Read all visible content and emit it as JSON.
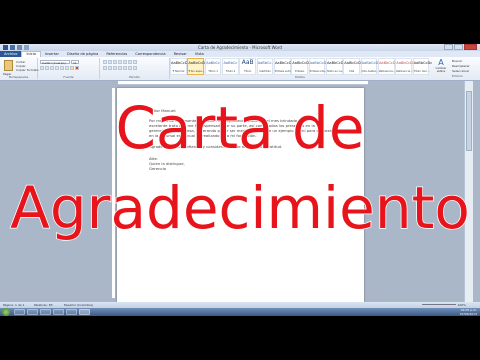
{
  "window": {
    "title": "Carta de Agradecimiento - Microsoft Word"
  },
  "ribbon": {
    "tabs": [
      "Archivo",
      "Inicio",
      "Insertar",
      "Diseño de página",
      "Referencias",
      "Correspondencia",
      "Revisar",
      "Vista"
    ],
    "active_tab": "Inicio",
    "clipboard": {
      "paste_label": "Pegar",
      "cut_label": "Cortar",
      "copy_label": "Copiar",
      "format_painter_label": "Copiar formato",
      "group_label": "Portapapeles"
    },
    "font": {
      "font_name": "Calibri (Cuerpo)",
      "font_size": "11",
      "group_label": "Fuente"
    },
    "paragraph": {
      "group_label": "Párrafo"
    },
    "styles": {
      "group_label": "Estilos",
      "items": [
        {
          "sample": "AaBbCcDc",
          "name": "¶ Normal"
        },
        {
          "sample": "AaBbCcDc",
          "name": "¶ Sin espa..."
        },
        {
          "sample": "AaBbCc",
          "name": "Título 1"
        },
        {
          "sample": "AaBbCc",
          "name": "Título 2"
        },
        {
          "sample": "AaB",
          "name": "Título"
        },
        {
          "sample": "AaBbCc.",
          "name": "Subtítulo"
        },
        {
          "sample": "AaBbCcDc",
          "name": "Énfasis sutil"
        },
        {
          "sample": "AaBbCcDc",
          "name": "Énfasis"
        },
        {
          "sample": "AaBbCcDc",
          "name": "Énfasis inte..."
        },
        {
          "sample": "AaBbCcDc",
          "name": "Texto en ne..."
        },
        {
          "sample": "AaBbCcDc",
          "name": "Cita"
        },
        {
          "sample": "AaBbCcDc",
          "name": "Cita destac..."
        },
        {
          "sample": "AaBbCcDc",
          "name": "Referencia..."
        },
        {
          "sample": "AaBbCcDc",
          "name": "Referencia..."
        },
        {
          "sample": "AaBbCcDc",
          "name": "Título del l..."
        }
      ],
      "change_styles_label": "Cambiar estilos"
    },
    "editing": {
      "group_label": "Edición",
      "find_label": "Buscar",
      "replace_label": "Reemplazar",
      "select_label": "Seleccionar"
    }
  },
  "document": {
    "lines": [
      "Señor Manuel:",
      "Por medio de la presente, le mando mis agradecimientos por el mes brindado y el",
      "excelente trato que me ha dispensado por su parte, así como todos los presentes en la",
      "gerencia de la empresa, esperando poder ser medio, y servir de un ejemplo de mí para empezar",
      "en la sucursal en la cual he realizado toda mi formación.",
      "Agradeciendo su confianza, y consideración. Me despido con gratitud.",
      "Atte.",
      "Quien la distingue,",
      "Gerencia"
    ]
  },
  "status_bar": {
    "page": "Página: 1 de 1",
    "words": "Palabras: 83",
    "language": "Español (Colombia)",
    "zoom": "100%"
  },
  "taskbar": {
    "time": "04:05 p.m.",
    "date": "07/06/2013"
  },
  "overlay": {
    "line1": "Carta de",
    "line2": "Agradecimiento",
    "color": "#e8141b"
  }
}
